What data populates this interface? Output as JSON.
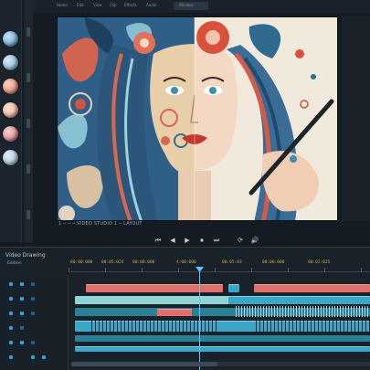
{
  "menu": {
    "items": [
      "Home",
      "Edit",
      "View",
      "Clip",
      "Effects",
      "Audio",
      "Window"
    ],
    "active": ""
  },
  "preview": {
    "caption": "1 ─ ─ ─ VIDEO STUDIO 1 ─ LAYOUT"
  },
  "transport": {
    "buttons": [
      "⏮",
      "◀",
      "▶",
      "⏹",
      "⏭",
      "⟳",
      "🔊"
    ]
  },
  "timeline": {
    "title": "Video Drawing",
    "subtitle": "Edition",
    "timecodes": [
      "00:00:000",
      "00:05:024",
      "00:08:000",
      "4:00:000",
      "00:05:03",
      "00:06:008",
      "00:02:025"
    ]
  },
  "colors": {
    "accent": "#5ec5ff",
    "clip_red": "#e0706c",
    "clip_blue": "#3aa7c9",
    "timecode": "#c9a75a"
  }
}
